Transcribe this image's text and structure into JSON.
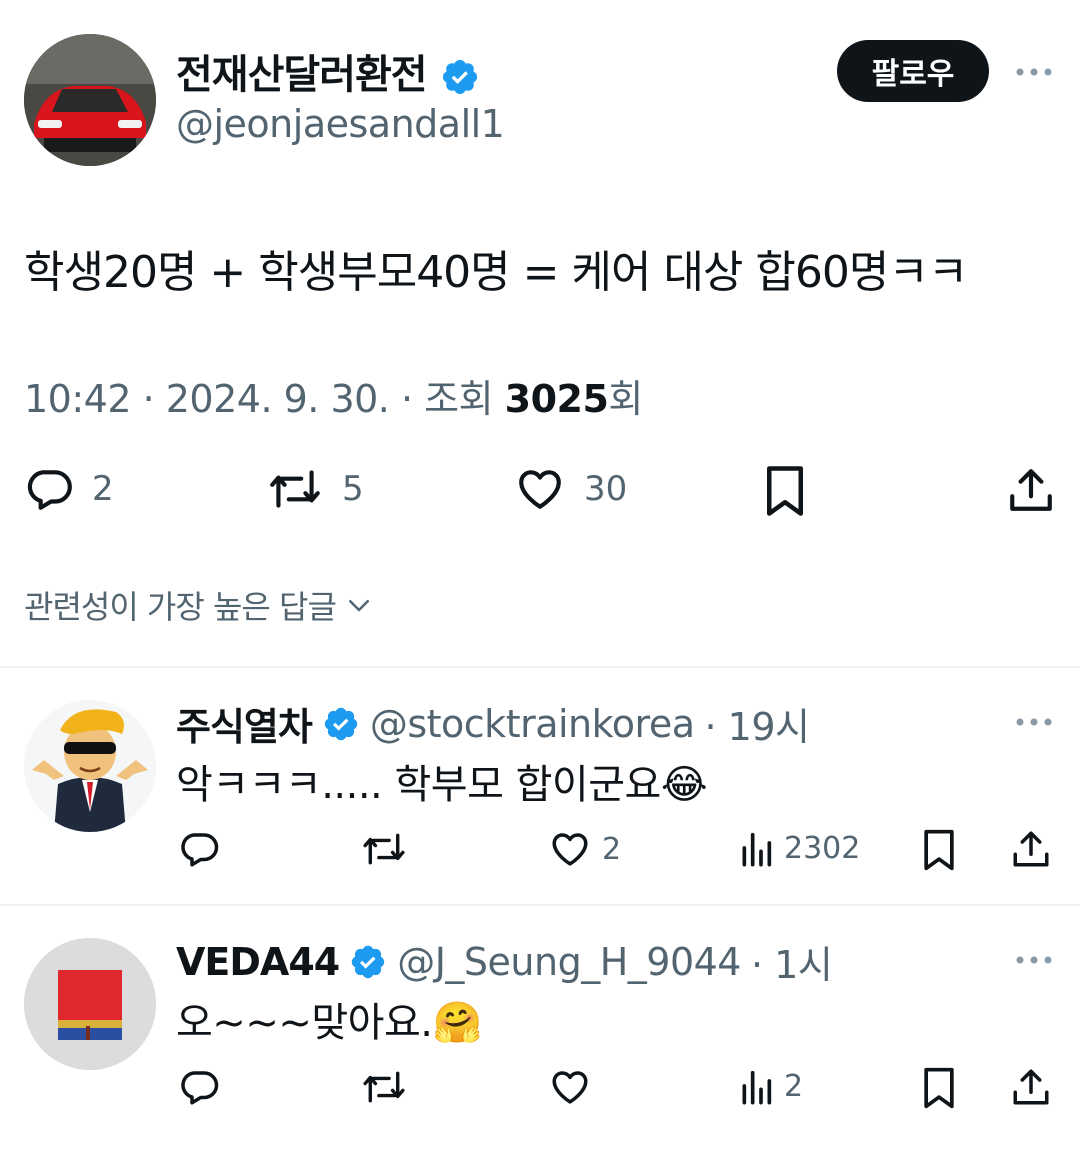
{
  "tweet": {
    "author_name": "전재산달러환전",
    "author_handle": "@jeonjaesandall1",
    "follow_label": "팔로우",
    "text": "학생20명 + 학생부모40명 = 케어 대상 합60명ㅋㅋ",
    "meta_prefix": "10:42 · 2024. 9. 30. · 조회 ",
    "views": "3025",
    "views_suffix": "회",
    "stats": {
      "replies": "2",
      "retweets": "5",
      "likes": "30"
    }
  },
  "replies_sort_label": "관련성이 가장 높은 답글",
  "replies": [
    {
      "name": "주식열차",
      "handle": "@stocktrainkorea",
      "time": "· 19시",
      "text": "악ㅋㅋㅋ..... 학부모 합이군요",
      "emoji": "😂",
      "likes": "2",
      "views": "2302"
    },
    {
      "name": "VEDA44",
      "handle": "@J_Seung_H_9044",
      "time": "· 1시",
      "text": "오~~~맞아요.",
      "emoji": "🤗",
      "likes": "",
      "views": "2"
    }
  ],
  "colors": {
    "verified": "#1d9bf0",
    "muted": "#536471",
    "text": "#0f1419",
    "divider": "#eff3f4"
  }
}
